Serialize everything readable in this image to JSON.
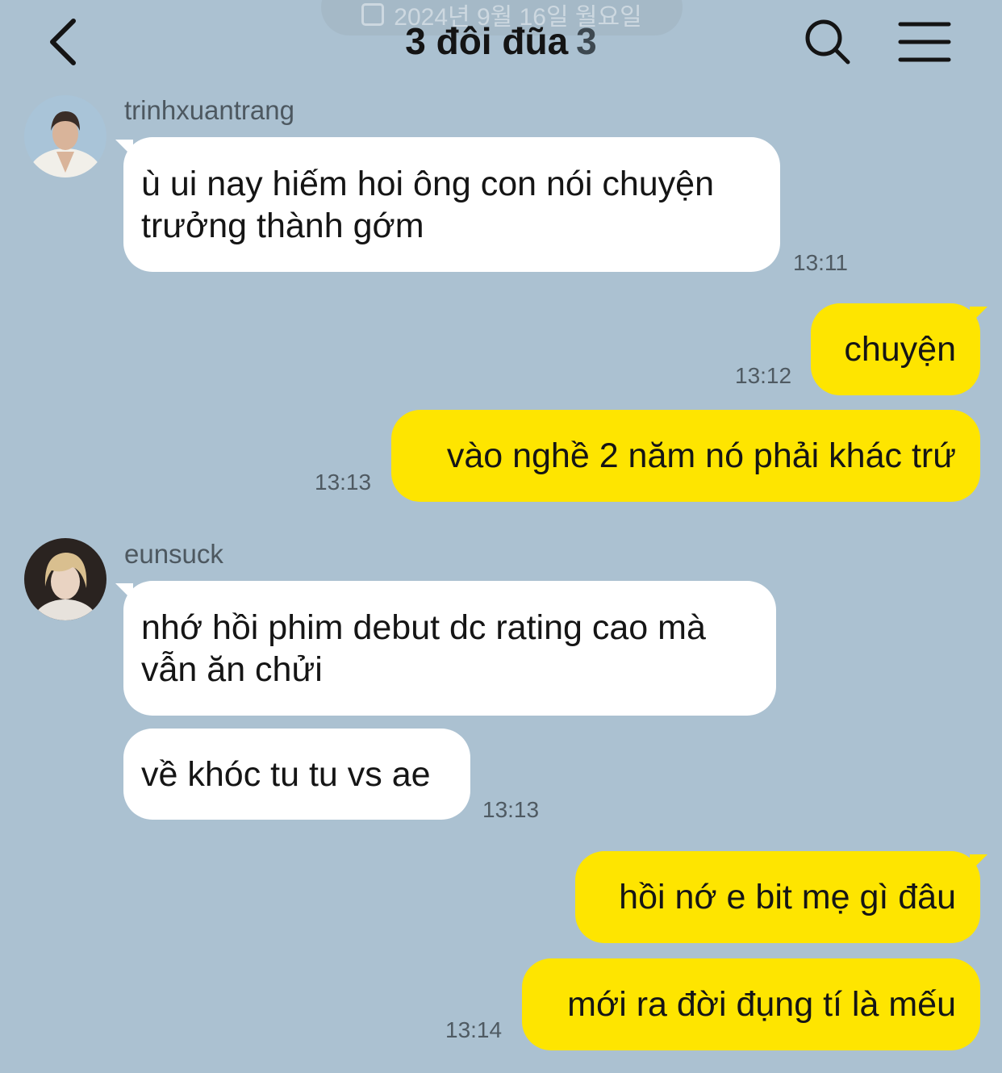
{
  "header": {
    "date": "2024년 9월 16일 월요일",
    "title": "3 đôi đũa",
    "member_count": "3",
    "back_icon": "back-chevron-icon",
    "search_icon": "search-icon",
    "menu_icon": "hamburger-menu-icon"
  },
  "colors": {
    "background": "#abc1d1",
    "incoming_bubble": "#ffffff",
    "outgoing_bubble": "#fee500"
  },
  "messages": [
    {
      "sender": "trinhxuantrang",
      "direction": "incoming",
      "text": "ù ui nay hiếm hoi ông con nói chuyện trưởng thành gớm",
      "time": "13:11"
    },
    {
      "direction": "outgoing",
      "text": "chuyện",
      "time": "13:12"
    },
    {
      "direction": "outgoing",
      "text": "vào nghề 2 năm nó phải khác trứ",
      "time": "13:13"
    },
    {
      "sender": "eunsuck",
      "direction": "incoming",
      "text": "nhớ hồi phim debut dc rating cao mà vẫn ăn chửi"
    },
    {
      "direction": "incoming",
      "text": "về khóc tu tu vs ae",
      "time": "13:13"
    },
    {
      "direction": "outgoing",
      "text": "hồi nớ e bit mẹ gì đâu"
    },
    {
      "direction": "outgoing",
      "text": "mới ra đời đụng tí là mếu",
      "time": "13:14"
    }
  ]
}
